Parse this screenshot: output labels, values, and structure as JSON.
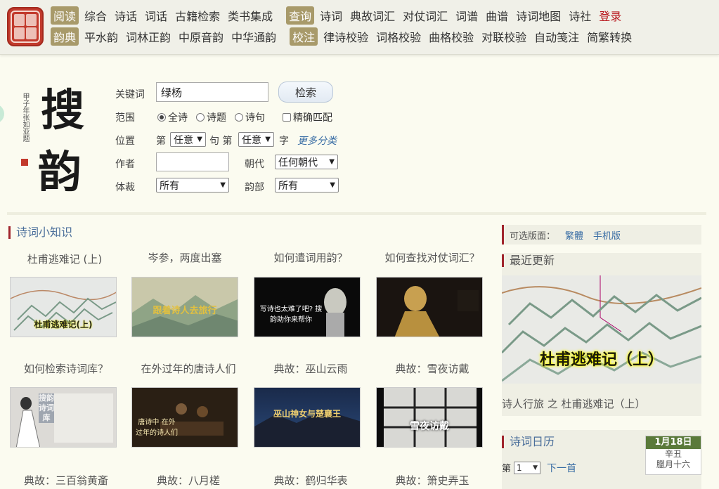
{
  "nav": {
    "row1_badge": "阅读",
    "row1_links": [
      "综合",
      "诗话",
      "词话",
      "古籍检索",
      "类书集成"
    ],
    "row1_badge2": "查询",
    "row1_links2": [
      "诗词",
      "典故词汇",
      "对仗词汇",
      "词谱",
      "曲谱",
      "诗词地图",
      "诗社"
    ],
    "login": "登录",
    "row2_badge": "韵典",
    "row2_links": [
      "平水韵",
      "词林正韵",
      "中原音韵",
      "中华通韵"
    ],
    "row2_badge2": "校注",
    "row2_links2": [
      "律诗校验",
      "词格校验",
      "曲格校验",
      "对联校验",
      "自动笺注",
      "简繁转换"
    ]
  },
  "brand": {
    "char1": "搜",
    "char2": "韵",
    "small_text": "甲子年张如亚题"
  },
  "search": {
    "keyword_label": "关键词",
    "keyword_value": "绿杨",
    "search_button": "检索",
    "scope_label": "范围",
    "scope_options": [
      "全诗",
      "诗题",
      "诗句"
    ],
    "exact_match": "精确匹配",
    "position_label": "位置",
    "pos_prefix": "第",
    "pos_any1": "任意",
    "pos_mid": "句 第",
    "pos_any2": "任意",
    "pos_suffix": "字",
    "more_categories": "更多分类",
    "author_label": "作者",
    "dynasty_label": "朝代",
    "dynasty_value": "任何朝代",
    "genre_label": "体裁",
    "genre_value": "所有",
    "rhyme_label": "韵部",
    "rhyme_value": "所有"
  },
  "knowledge": {
    "title": "诗词小知识",
    "row1": [
      "杜甫逃难记 (上)",
      "岑参，两度出塞",
      "如何遣词用韵？",
      "如何查找对仗词汇？"
    ],
    "row1_captions": [
      "杜甫逃难记(上)",
      "跟着诗人去旅行",
      "写诗也太难了吧? 搜韵助你来帮你",
      ""
    ],
    "row2": [
      "如何检索诗词库？",
      "在外过年的唐诗人们",
      "典故：巫山云雨",
      "典故：雪夜访戴"
    ],
    "row2_captions": [
      "搜韵诗词库",
      "唐诗中 在外过年的诗人们",
      "巫山神女与楚襄王",
      "雪夜访戴"
    ],
    "row3": [
      "典故：三百翁黄齑",
      "典故：八月槎",
      "典故：鹤归华表",
      "典故：箫史弄玉"
    ]
  },
  "right": {
    "edition_label": "可选版面：",
    "edition_options": [
      "繁體",
      "手机版"
    ],
    "recent_title": "最近更新",
    "recent_caption": "诗人行旅 之 杜甫逃难记（上）",
    "recent_img_caption": "杜甫逃难记（上）",
    "calendar_title": "诗词日历",
    "calendar_date": "1月18日",
    "calendar_ganzhi": "辛丑",
    "calendar_lunar": "臘月十六",
    "page_prefix": "第",
    "page_value": "1",
    "next_page": "下一首"
  },
  "colors": {
    "accent_red": "#a0242c",
    "link_blue": "#3a6ea5",
    "badge": "#a89a6a"
  }
}
